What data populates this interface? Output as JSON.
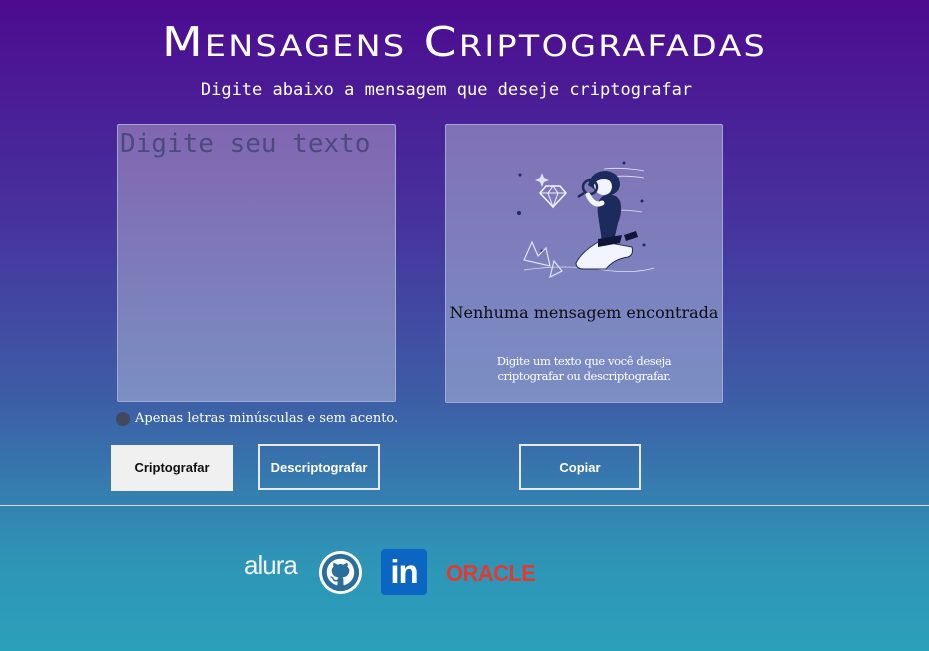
{
  "header": {
    "title": "Mensagens Criptografadas",
    "subtitle": "Digite abaixo a mensagem que deseje criptografar"
  },
  "input": {
    "placeholder": "Digite seu texto",
    "value": ""
  },
  "output": {
    "illustration": "person-with-magnifier-illustration",
    "empty_title": "Nenhuma mensagem encontrada",
    "empty_text": "Digite um texto que você deseja criptografar ou descriptografar."
  },
  "hint": {
    "icon": "info-icon",
    "text": "Apenas letras minúsculas e sem acento."
  },
  "buttons": {
    "encrypt": "Criptografar",
    "decrypt": "Descriptografar",
    "copy": "Copiar"
  },
  "footer": {
    "logos": [
      {
        "name": "alura",
        "text": "alura"
      },
      {
        "name": "github",
        "icon": "github-icon"
      },
      {
        "name": "linkedin",
        "text": "in"
      },
      {
        "name": "oracle",
        "text": "ORACLE"
      }
    ]
  },
  "colors": {
    "gradient_top": "#4d0b90",
    "gradient_bottom": "#2aa1bb",
    "linkedin": "#0a66c2",
    "oracle": "#e23a2f"
  }
}
